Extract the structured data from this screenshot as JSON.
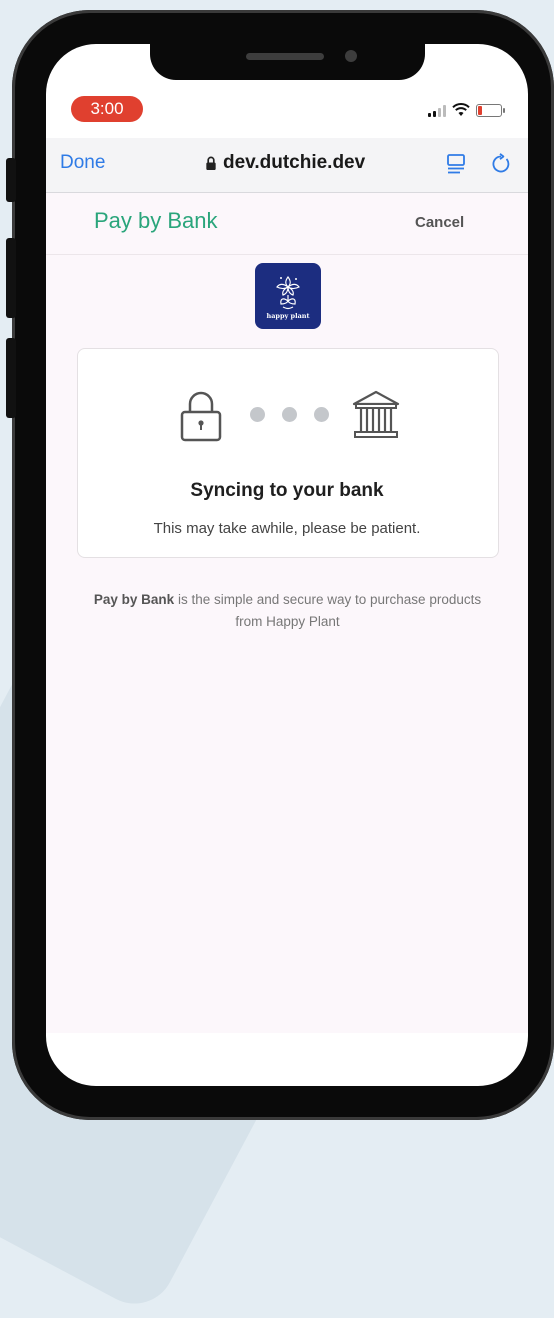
{
  "status_bar": {
    "time": "3:00"
  },
  "browser": {
    "done_label": "Done",
    "url": "dev.dutchie.dev"
  },
  "page": {
    "title": "Pay by Bank",
    "cancel_label": "Cancel",
    "logo_text": "happy plant"
  },
  "sync_card": {
    "title": "Syncing to your bank",
    "subtitle": "This may take awhile, please be patient."
  },
  "footer": {
    "bold": "Pay by Bank",
    "rest": " is the simple and secure way to purchase products from Happy Plant"
  },
  "colors": {
    "accent_green": "#2aa57b",
    "link_blue": "#2f7be6",
    "time_pill": "#e0402f",
    "logo_bg": "#1c2d80"
  },
  "icons": [
    "lock-icon",
    "bank-icon",
    "reader-icon",
    "reload-icon",
    "signal-icon",
    "wifi-icon",
    "battery-icon"
  ]
}
